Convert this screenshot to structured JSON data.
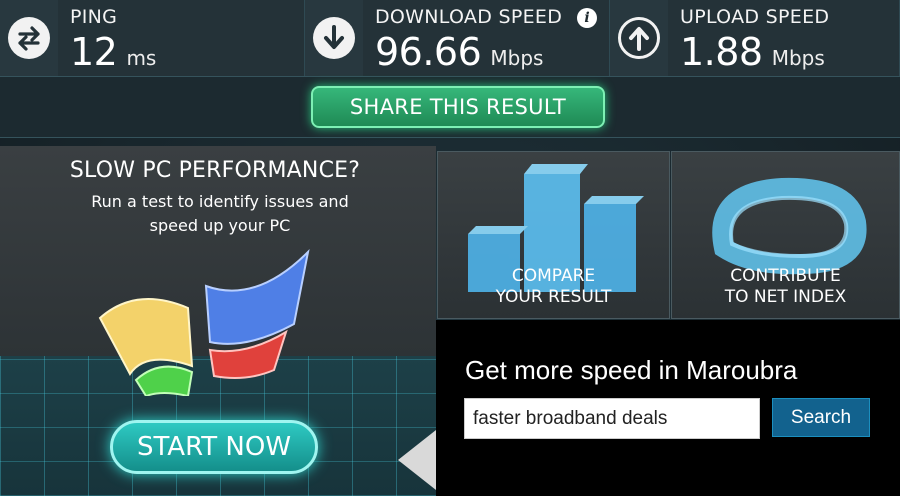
{
  "metrics": {
    "ping": {
      "label": "PING",
      "value": "12",
      "unit": "ms",
      "icon": "ping-arrows-icon"
    },
    "download": {
      "label": "DOWNLOAD SPEED",
      "value": "96.66",
      "unit": "Mbps",
      "icon": "download-arrow-icon",
      "info_icon": "i"
    },
    "upload": {
      "label": "UPLOAD SPEED",
      "value": "1.88",
      "unit": "Mbps",
      "icon": "upload-arrow-icon"
    }
  },
  "share": {
    "label": "SHARE THIS RESULT"
  },
  "promo": {
    "title": "SLOW PC PERFORMANCE?",
    "subtitle": "Run a test to identify issues and speed up your PC",
    "button": "START NOW"
  },
  "tiles": {
    "compare": {
      "label_line1": "COMPARE",
      "label_line2": "YOUR RESULT"
    },
    "contribute": {
      "label_line1": "CONTRIBUTE",
      "label_line2": "TO NET INDEX"
    }
  },
  "ad": {
    "headline": "Get more speed in Maroubra",
    "search_value": "faster broadband deals",
    "search_button": "Search"
  },
  "colors": {
    "share_green": "#2aa86a",
    "start_teal": "#21b1ab",
    "search_blue": "#12628e",
    "metric_bg": "#243238"
  }
}
